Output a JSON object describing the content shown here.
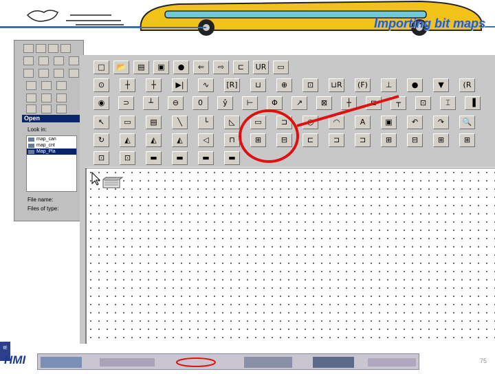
{
  "slide": {
    "title": "Importing bit maps",
    "footer_text": "HMI",
    "page_number": "75",
    "footer_logo_text": "IE"
  },
  "dialog": {
    "title": "Open",
    "look_in_label": "Look in:",
    "file_name_label": "File name:",
    "files_of_type_label": "Files of type:",
    "files": [
      {
        "name": "map_can",
        "selected": false
      },
      {
        "name": "map_cnt",
        "selected": false
      },
      {
        "name": "Map_Pla",
        "selected": true
      }
    ]
  },
  "toolbar": {
    "row1": [
      "new-icon",
      "open-icon",
      "save-icon",
      "save-as-icon",
      "record-icon",
      "back-icon",
      "play-icon",
      "layers-icon",
      "ur-icon",
      "screen-icon"
    ],
    "row1_glyphs": [
      "□",
      "📂",
      "▤",
      "▣",
      "●",
      "⇐",
      "⇨",
      "⊏",
      "UR",
      "▭"
    ],
    "row2_glyphs": [
      "⊙",
      "┼",
      "┼",
      "▶|",
      "∿",
      "[R]",
      "⊔",
      "⊕",
      "⊡",
      "⊔R",
      "(F)",
      "⊥",
      "●",
      "▼",
      "(R"
    ],
    "row3_glyphs": [
      "◉",
      "⊃",
      "┴",
      "⊖",
      "0",
      "ŷ",
      "⊢",
      "Φ",
      "↗",
      "⊠",
      "┼",
      "⊏",
      "┬",
      "⊡",
      "⌶",
      "▐"
    ],
    "row4_glyphs": [
      "↖",
      "▭",
      "▤",
      "╲",
      "└",
      "◺",
      "▭",
      "⊐",
      "○",
      "◠",
      "A",
      "▣",
      "↶",
      "↷",
      "🔍"
    ],
    "row5_glyphs": [
      "↻",
      "◭",
      "◭",
      "◭",
      "◁",
      "⊓",
      "⊞",
      "⊟",
      "⊏",
      "⊐",
      "⊐",
      "⊞",
      "⊟",
      "⊞",
      "⊞"
    ],
    "row6_glyphs": [
      "⊡",
      "⊡",
      "▬",
      "▬",
      "▬",
      "▬"
    ]
  },
  "colors": {
    "accent": "#e01010",
    "title_blue": "#2b5fb3",
    "selection": "#0a246a"
  }
}
